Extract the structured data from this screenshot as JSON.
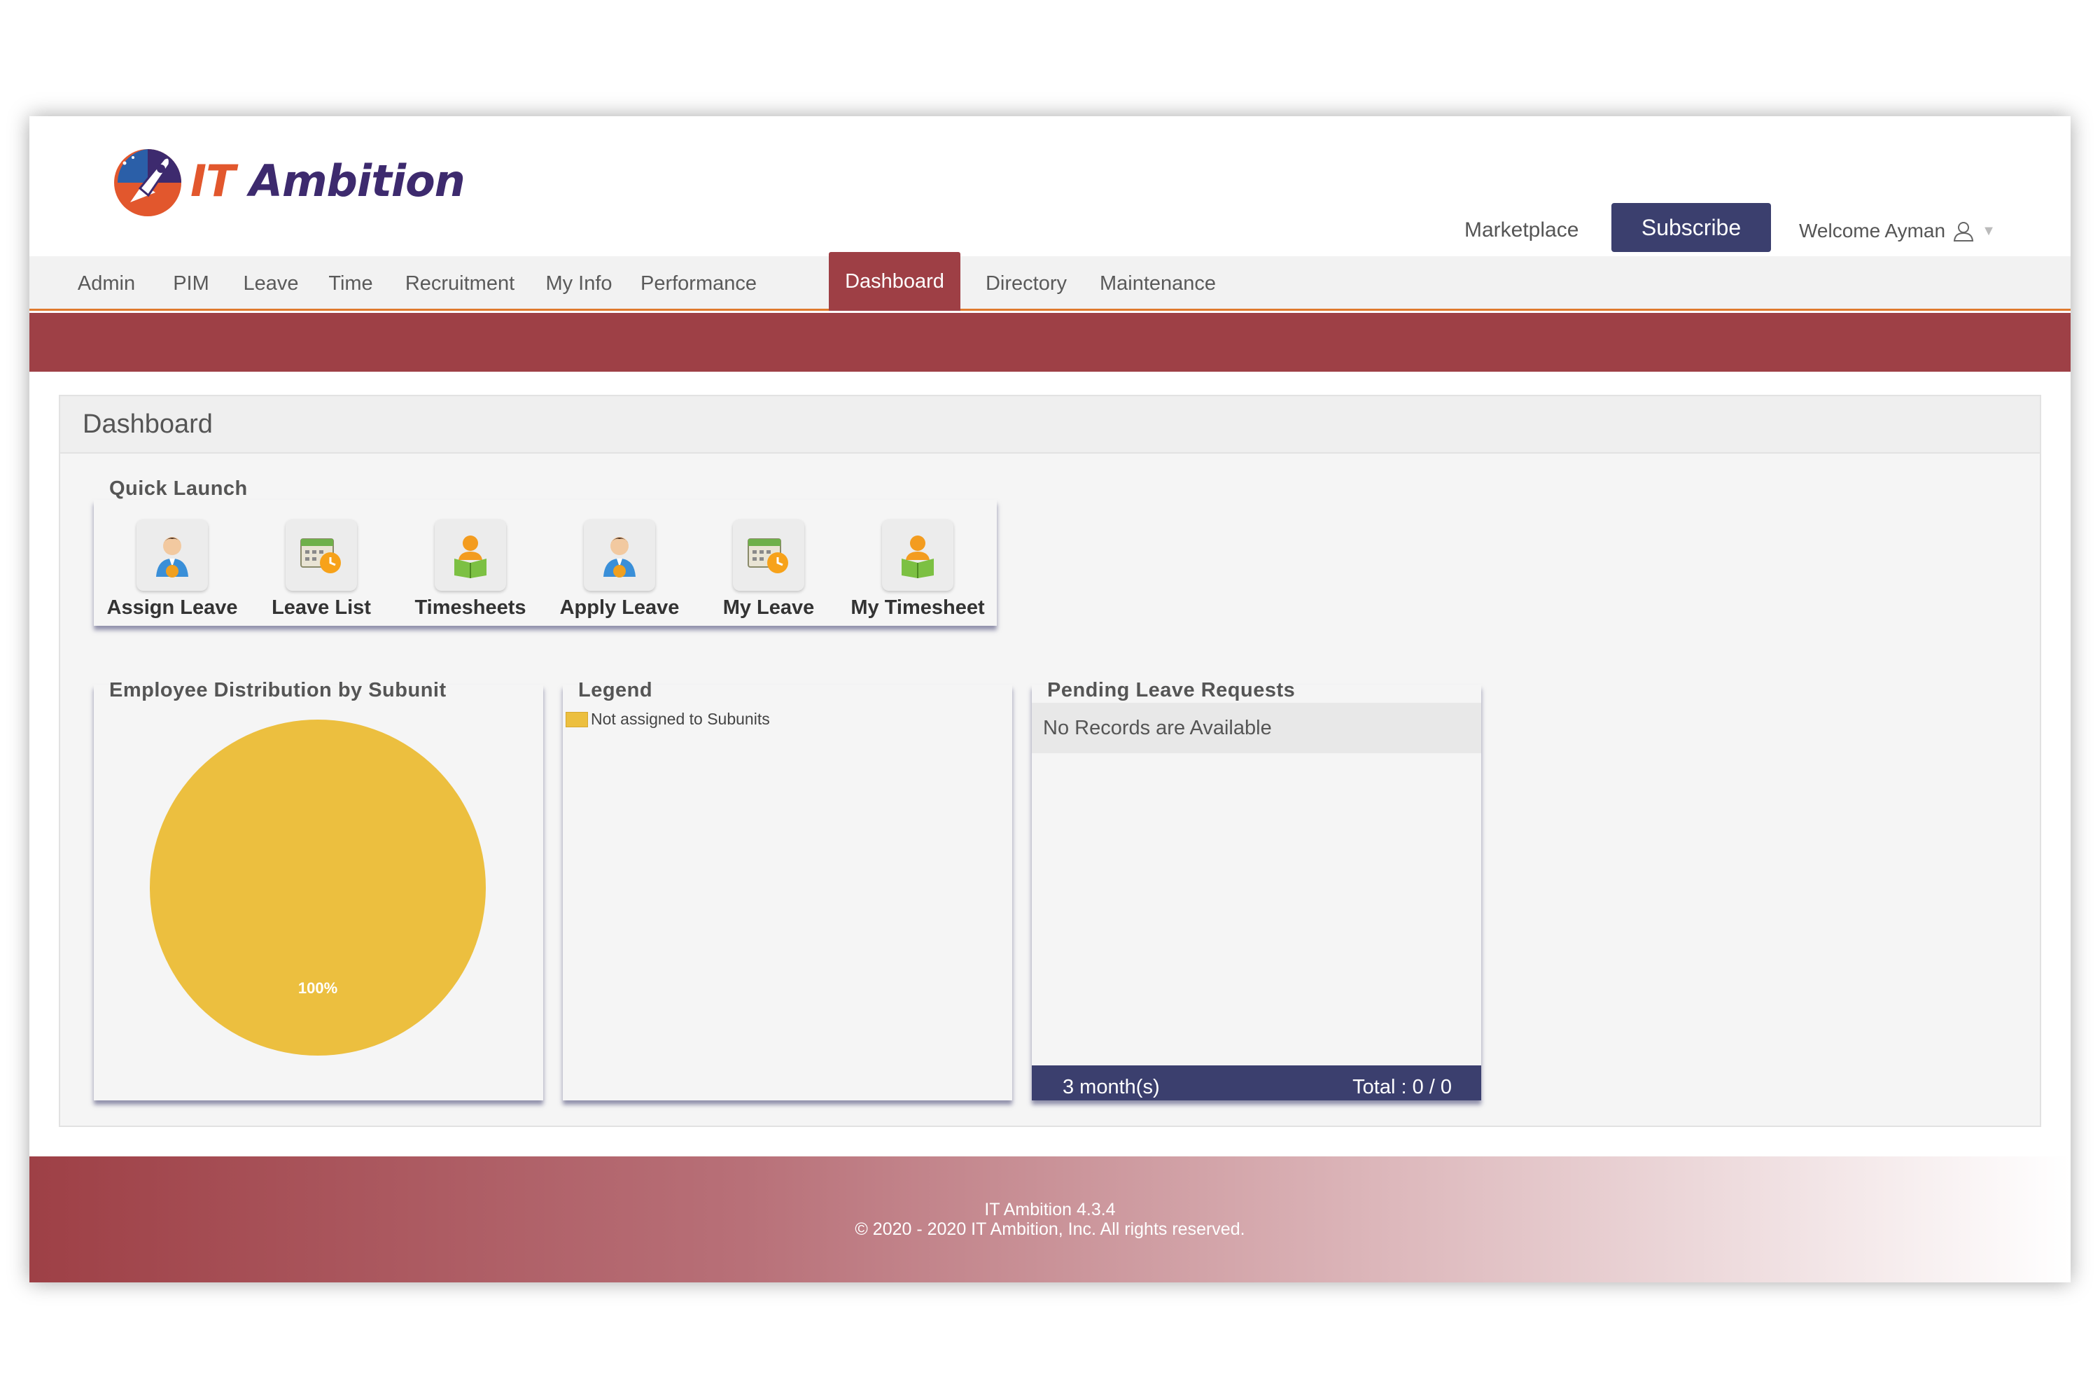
{
  "brand": {
    "logo_text_it": "IT",
    "logo_text_rest": "Ambition"
  },
  "header": {
    "marketplace": "Marketplace",
    "subscribe": "Subscribe",
    "welcome": "Welcome Ayman"
  },
  "nav": {
    "items": [
      "Admin",
      "PIM",
      "Leave",
      "Time",
      "Recruitment",
      "My Info",
      "Performance",
      "Dashboard",
      "Directory",
      "Maintenance"
    ],
    "active": "Dashboard"
  },
  "dashboard": {
    "title": "Dashboard",
    "quick_launch": {
      "title": "Quick Launch",
      "items": [
        {
          "label": "Assign Leave",
          "icon": "person-icon"
        },
        {
          "label": "Leave List",
          "icon": "calendar-clock-icon"
        },
        {
          "label": "Timesheets",
          "icon": "reading-person-icon"
        },
        {
          "label": "Apply Leave",
          "icon": "person-icon"
        },
        {
          "label": "My Leave",
          "icon": "calendar-clock-icon"
        },
        {
          "label": "My Timesheet",
          "icon": "reading-person-icon"
        }
      ]
    },
    "distribution": {
      "title": "Employee Distribution by Subunit"
    },
    "legend": {
      "title": "Legend",
      "items": [
        {
          "label": "Not assigned to Subunits",
          "color": "#ecbf3f"
        }
      ]
    },
    "pending": {
      "title": "Pending Leave Requests",
      "empty": "No Records are Available",
      "period": "3 month(s)",
      "total": "Total : 0 / 0"
    }
  },
  "chart_data": {
    "type": "pie",
    "title": "Employee Distribution by Subunit",
    "categories": [
      "Not assigned to Subunits"
    ],
    "values": [
      100
    ],
    "data_labels": [
      "100%"
    ],
    "colors": [
      "#ecbf3f"
    ]
  },
  "footer": {
    "version": "IT Ambition 4.3.4",
    "copyright": "© 2020 - 2020 IT Ambition, Inc. All rights reserved."
  },
  "colors": {
    "brand_red": "#9e4046",
    "navy": "#3b3f6e",
    "accent_orange": "#e07a2e",
    "pie_yellow": "#ecbf3f"
  }
}
